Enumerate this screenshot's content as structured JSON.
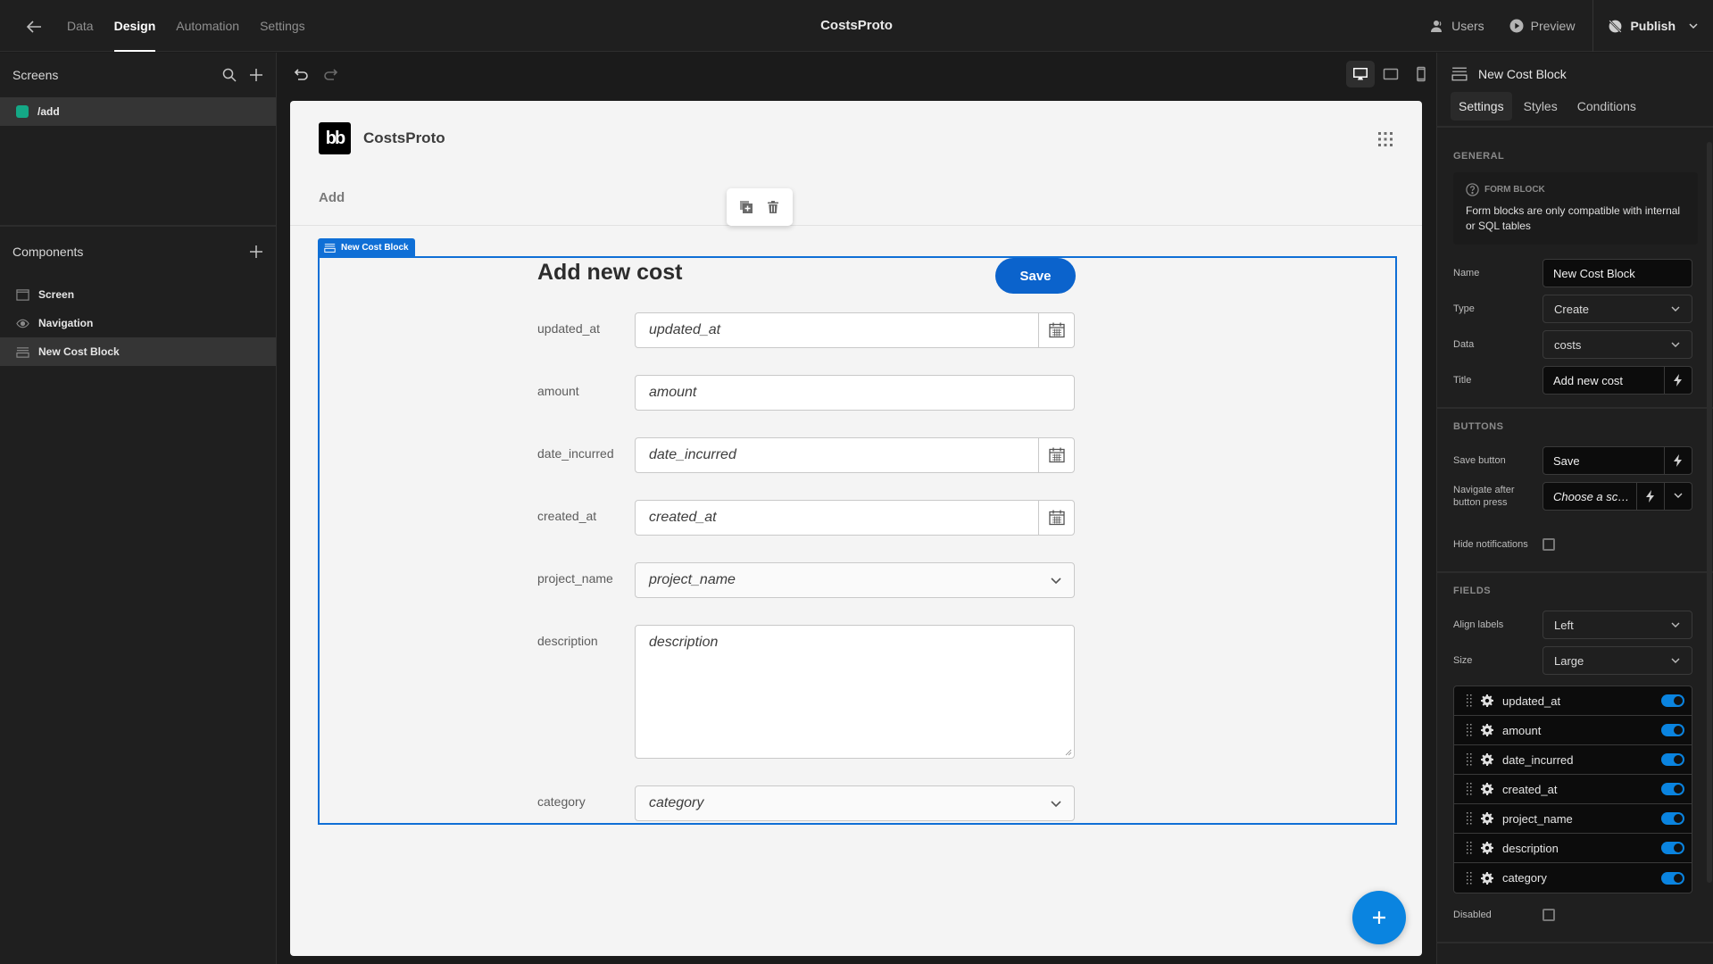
{
  "topbar": {
    "tabs": [
      {
        "label": "Data",
        "active": false
      },
      {
        "label": "Design",
        "active": true
      },
      {
        "label": "Automation",
        "active": false
      },
      {
        "label": "Settings",
        "active": false
      }
    ],
    "app_title": "CostsProto",
    "users_label": "Users",
    "preview_label": "Preview",
    "publish_label": "Publish"
  },
  "left_panel": {
    "screens_title": "Screens",
    "screens": [
      {
        "route": "/add",
        "color": "#14a886"
      }
    ],
    "components_title": "Components",
    "components": [
      {
        "label": "Screen",
        "icon": "screen-icon"
      },
      {
        "label": "Navigation",
        "icon": "eye-icon"
      },
      {
        "label": "New Cost Block",
        "icon": "form-block-icon",
        "selected": true
      }
    ]
  },
  "canvas": {
    "device_modes": [
      "desktop",
      "tablet",
      "mobile"
    ],
    "active_device": "desktop",
    "app_name": "CostsProto",
    "logo_text": "bb",
    "nav_link": "Add",
    "block_tag": "New Cost Block",
    "form": {
      "title": "Add new cost",
      "save_label": "Save",
      "fields": [
        {
          "label": "updated_at",
          "placeholder": "updated_at",
          "kind": "date"
        },
        {
          "label": "amount",
          "placeholder": "amount",
          "kind": "text"
        },
        {
          "label": "date_incurred",
          "placeholder": "date_incurred",
          "kind": "date"
        },
        {
          "label": "created_at",
          "placeholder": "created_at",
          "kind": "date"
        },
        {
          "label": "project_name",
          "placeholder": "project_name",
          "kind": "select"
        },
        {
          "label": "description",
          "placeholder": "description",
          "kind": "textarea"
        },
        {
          "label": "category",
          "placeholder": "category",
          "kind": "select"
        }
      ]
    }
  },
  "right_panel": {
    "component_name": "New Cost Block",
    "tabs": [
      {
        "label": "Settings",
        "active": true
      },
      {
        "label": "Styles",
        "active": false
      },
      {
        "label": "Conditions",
        "active": false
      }
    ],
    "general": {
      "title": "GENERAL",
      "info_title": "FORM BLOCK",
      "info_text": "Form blocks are only compatible with internal or SQL tables",
      "name_label": "Name",
      "name_value": "New Cost Block",
      "type_label": "Type",
      "type_value": "Create",
      "data_label": "Data",
      "data_value": "costs",
      "title_label": "Title",
      "title_value": "Add new cost"
    },
    "buttons": {
      "title": "BUTTONS",
      "save_label": "Save button",
      "save_value": "Save",
      "navigate_label": "Navigate after button press",
      "navigate_placeholder": "Choose a sc…",
      "hide_notifications_label": "Hide notifications",
      "hide_notifications_checked": false
    },
    "fields": {
      "title": "FIELDS",
      "align_label": "Align labels",
      "align_value": "Left",
      "size_label": "Size",
      "size_value": "Large",
      "items": [
        {
          "name": "updated_at",
          "enabled": true
        },
        {
          "name": "amount",
          "enabled": true
        },
        {
          "name": "date_incurred",
          "enabled": true
        },
        {
          "name": "created_at",
          "enabled": true
        },
        {
          "name": "project_name",
          "enabled": true
        },
        {
          "name": "description",
          "enabled": true
        },
        {
          "name": "category",
          "enabled": true
        }
      ],
      "disabled_label": "Disabled",
      "disabled_checked": false
    }
  },
  "colors": {
    "accent": "#0f6fd6",
    "save_button": "#0b63cc",
    "fab": "#0a84e0",
    "toggle_on": "#0a84e0",
    "screen_dot": "#14a886"
  }
}
